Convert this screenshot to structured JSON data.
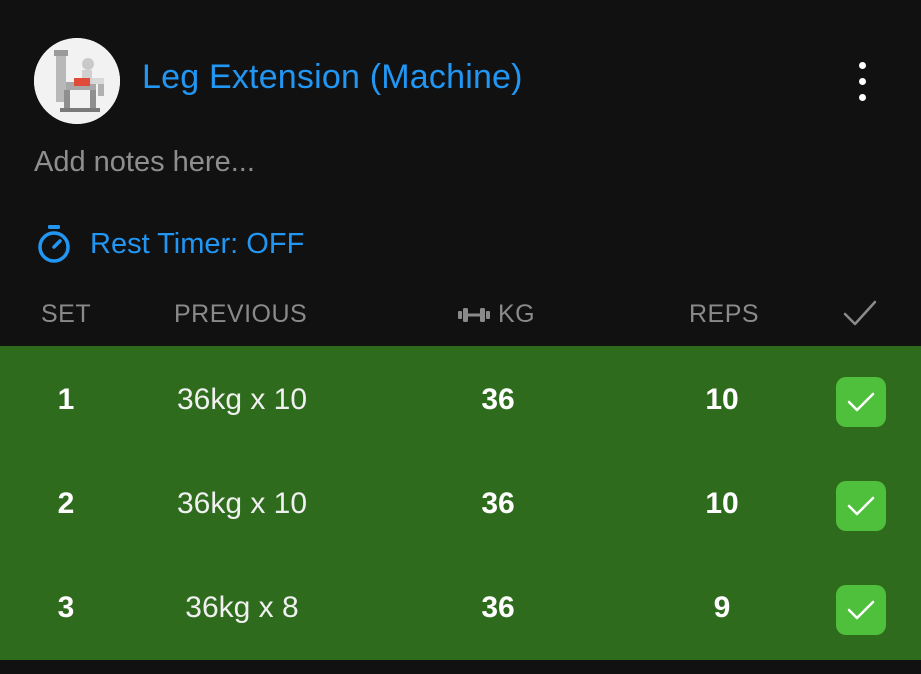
{
  "exercise": {
    "title": "Leg Extension (Machine)",
    "image_icon": "leg-extension-machine-thumbnail",
    "menu_icon": "more-vertical-icon"
  },
  "notes": {
    "placeholder": "Add notes here..."
  },
  "rest_timer": {
    "icon": "stopwatch-icon",
    "label": "Rest Timer: OFF"
  },
  "columns": {
    "set": "SET",
    "previous": "PREVIOUS",
    "kg": "KG",
    "kg_icon": "dumbbell-icon",
    "reps": "REPS",
    "done_icon": "check-icon"
  },
  "sets": [
    {
      "set": "1",
      "previous": "36kg x 10",
      "kg": "36",
      "reps": "10",
      "completed": true
    },
    {
      "set": "2",
      "previous": "36kg x 10",
      "kg": "36",
      "reps": "10",
      "completed": true
    },
    {
      "set": "3",
      "previous": "36kg x 8",
      "kg": "36",
      "reps": "9",
      "completed": true
    }
  ],
  "colors": {
    "accent_blue": "#2196f3",
    "completed_row_green": "#2e6b1d",
    "check_green": "#4fc03c",
    "background": "#111111"
  }
}
